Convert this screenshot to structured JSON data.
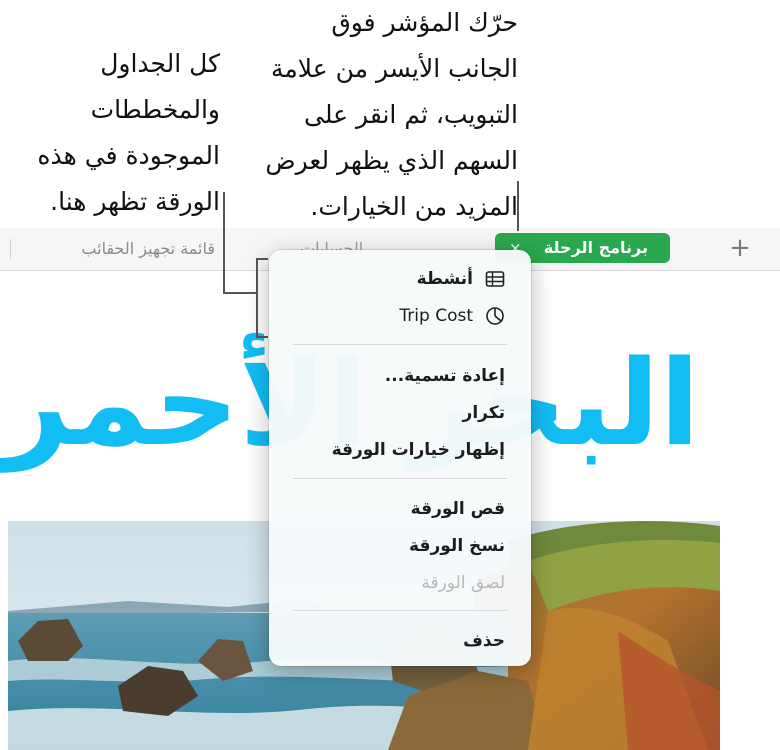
{
  "callouts": {
    "right_lines": [
      "حرّك المؤشر فوق",
      "الجانب الأيسر من علامة",
      "التبويب، ثم انقر على",
      "السهم الذي يظهر لعرض",
      "المزيد من الخيارات."
    ],
    "left_lines": [
      "كل الجداول",
      "والمخططات",
      "الموجودة في هذه",
      "الورقة تظهر هنا."
    ]
  },
  "tabs": {
    "add_label": "+",
    "active": {
      "label": "برنامج الرحلة",
      "close_glyph": "×"
    },
    "inactive": {
      "label": "قائمة تجهيز الحقائب"
    },
    "hidden_fragment": "الحسابات"
  },
  "document": {
    "title": "البحر الأحمر"
  },
  "menu": {
    "objects": [
      {
        "label": "أنشطة",
        "icon": "table-icon"
      },
      {
        "label": "Trip Cost",
        "icon": "pie-chart-icon"
      }
    ],
    "actions": [
      {
        "label": "إعادة تسمية...",
        "enabled": true
      },
      {
        "label": "تكرار",
        "enabled": true
      },
      {
        "label": "إظهار خيارات الورقة",
        "enabled": true
      }
    ],
    "clipboard": [
      {
        "label": "قص الورقة",
        "enabled": true
      },
      {
        "label": "نسخ الورقة",
        "enabled": true
      },
      {
        "label": "لصق الورقة",
        "enabled": false
      }
    ],
    "delete": {
      "label": "حذف"
    }
  },
  "colors": {
    "active_tab": "#2aa84f",
    "title": "#12bdf4"
  }
}
